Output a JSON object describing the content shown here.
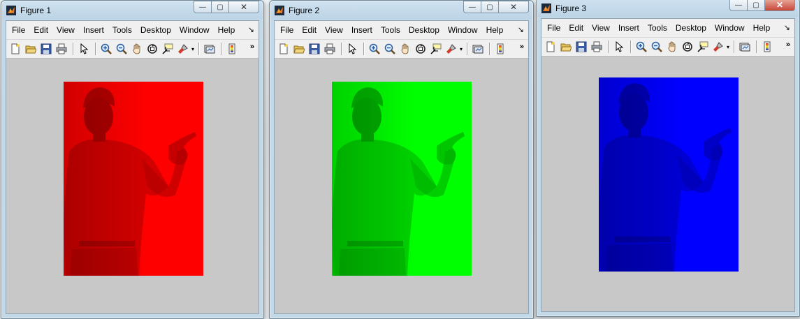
{
  "menu": [
    "File",
    "Edit",
    "View",
    "Insert",
    "Tools",
    "Desktop",
    "Window",
    "Help"
  ],
  "windows": [
    {
      "title": "Figure 1",
      "channel": "red",
      "color": "#ff0000",
      "dark": "#6a0000"
    },
    {
      "title": "Figure 2",
      "channel": "green",
      "color": "#00ff00",
      "dark": "#006a00"
    },
    {
      "title": "Figure 3",
      "channel": "blue",
      "color": "#0000ff",
      "dark": "#00006a"
    }
  ],
  "caption": {
    "minimize": "—",
    "maximize": "▢",
    "close": "✕"
  },
  "toolbar_icons": [
    "new-figure-icon",
    "open-file-icon",
    "save-icon",
    "print-icon",
    "edit-plot-arrow-icon",
    "zoom-in-icon",
    "zoom-out-icon",
    "pan-hand-icon",
    "rotate-3d-icon",
    "data-cursor-icon",
    "brush-icon",
    "link-plot-icon",
    "colorbar-icon"
  ],
  "overflow": "»",
  "menu_overflow": "↘"
}
